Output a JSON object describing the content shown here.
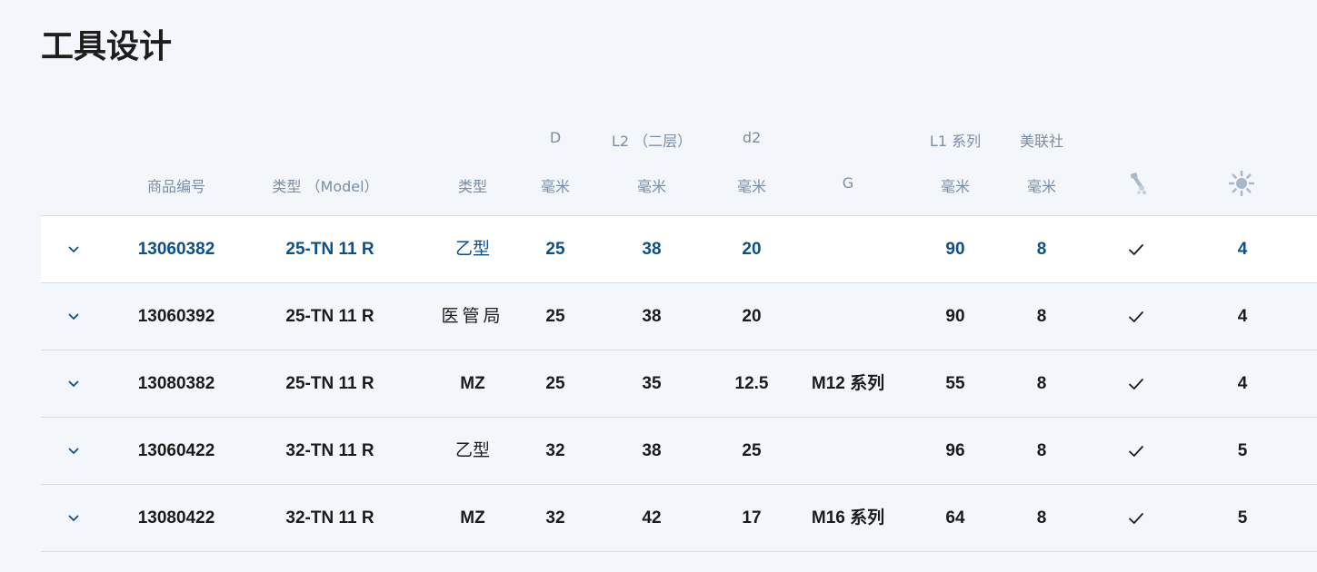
{
  "page": {
    "title": "工具设计"
  },
  "table": {
    "headers_top": {
      "d": "D",
      "l2": "L2 （二层）",
      "d2": "d2",
      "l1": "L1 系列",
      "z": "美联社"
    },
    "headers": {
      "part_no": "商品编号",
      "model": "类型 （Model）",
      "type": "类型",
      "d": "毫米",
      "l2": "毫米",
      "d2": "毫米",
      "g": "G",
      "l1": "毫米",
      "z": "毫米",
      "coolant_icon": "coolant-icon",
      "speed_icon": "sun-icon"
    },
    "rows": [
      {
        "part_no": "13060382",
        "model": "25-TN 11 R",
        "type": "乙型",
        "d": "25",
        "l2": "38",
        "d2": "20",
        "g": "",
        "l1": "90",
        "z": "8",
        "coolant": true,
        "speed": "4",
        "selected": true
      },
      {
        "part_no": "13060392",
        "model": "25-TN 11 R",
        "type": "医管局",
        "d": "25",
        "l2": "38",
        "d2": "20",
        "g": "",
        "l1": "90",
        "z": "8",
        "coolant": true,
        "speed": "4",
        "selected": false
      },
      {
        "part_no": "13080382",
        "model": "25-TN 11 R",
        "type": "MZ",
        "d": "25",
        "l2": "35",
        "d2": "12.5",
        "g": "M12 系列",
        "l1": "55",
        "z": "8",
        "coolant": true,
        "speed": "4",
        "selected": false
      },
      {
        "part_no": "13060422",
        "model": "32-TN 11 R",
        "type": "乙型",
        "d": "32",
        "l2": "38",
        "d2": "25",
        "g": "",
        "l1": "96",
        "z": "8",
        "coolant": true,
        "speed": "5",
        "selected": false
      },
      {
        "part_no": "13080422",
        "model": "32-TN 11 R",
        "type": "MZ",
        "d": "32",
        "l2": "42",
        "d2": "17",
        "g": "M16 系列",
        "l1": "64",
        "z": "8",
        "coolant": true,
        "speed": "5",
        "selected": false
      }
    ]
  },
  "colors": {
    "background": "#f3f6fa",
    "selected_row_bg": "#ffffff",
    "selected_row_text": "#0d4f8b",
    "header_text": "#7b8ea4",
    "divider": "#d7dde5"
  }
}
